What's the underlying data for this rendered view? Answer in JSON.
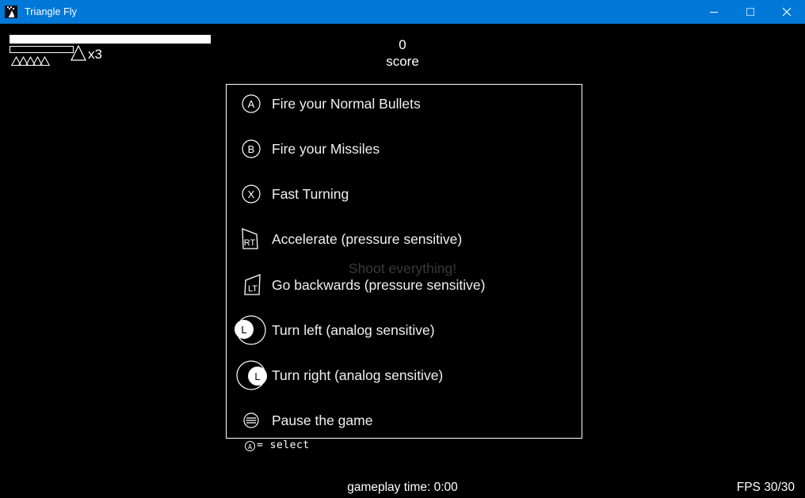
{
  "window": {
    "title": "Triangle Fly",
    "app_icon": "triangle-fly-app-icon",
    "accent_color": "#0078d7",
    "controls": {
      "minimize": "minimize-icon",
      "maximize": "maximize-icon",
      "close": "close-icon"
    }
  },
  "hud": {
    "health_bar_label": "health-bar",
    "energy_bar_label": "energy-bar",
    "ammo_indicator_label": "ammo-triangles",
    "lives_multiplier": "x3",
    "score_value": "0",
    "score_label": "score"
  },
  "background_hint": "Shoot everything!",
  "controls_panel": {
    "rows": [
      {
        "icon": "button-a-icon",
        "button": "A",
        "label": "Fire your Normal Bullets"
      },
      {
        "icon": "button-b-icon",
        "button": "B",
        "label": "Fire your Missiles"
      },
      {
        "icon": "button-x-icon",
        "button": "X",
        "label": "Fast Turning"
      },
      {
        "icon": "trigger-rt-icon",
        "button": "RT",
        "label": "Accelerate (pressure sensitive)"
      },
      {
        "icon": "trigger-lt-icon",
        "button": "LT",
        "label": "Go backwards (pressure sensitive)"
      },
      {
        "icon": "stick-left-icon",
        "button": "L",
        "label": "Turn left (analog sensitive)"
      },
      {
        "icon": "stick-right-icon",
        "button": "L",
        "label": "Turn right (analog sensitive)"
      },
      {
        "icon": "pause-menu-icon",
        "button": "",
        "label": "Pause the game"
      }
    ]
  },
  "select_hint": {
    "icon": "button-a-icon",
    "text": "= select"
  },
  "status_bar": {
    "gameplay_time": "gameplay time: 0:00",
    "fps": "FPS 30/30"
  }
}
